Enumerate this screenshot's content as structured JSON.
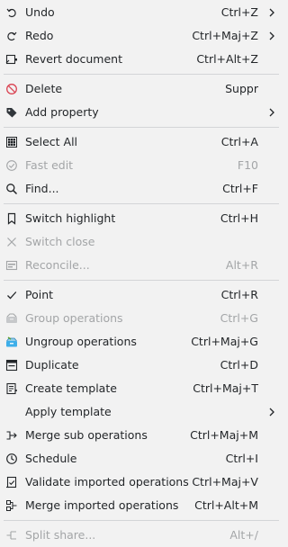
{
  "colors": {
    "background": "#f2f2f2",
    "text": "#232629",
    "disabled_text": "#a3a5a7",
    "separator": "#d3d5d7",
    "delete_icon": "#da4453"
  },
  "menu": {
    "items": [
      {
        "id": "undo",
        "label": "Undo",
        "shortcut": "Ctrl+Z",
        "enabled": true,
        "submenu": true,
        "icon": "undo-icon"
      },
      {
        "id": "redo",
        "label": "Redo",
        "shortcut": "Ctrl+Maj+Z",
        "enabled": true,
        "submenu": true,
        "icon": "redo-icon"
      },
      {
        "id": "revert-document",
        "label": "Revert document",
        "shortcut": "Ctrl+Alt+Z",
        "enabled": true,
        "submenu": false,
        "icon": "revert-icon"
      },
      {
        "id": "delete",
        "label": "Delete",
        "shortcut": "Suppr",
        "enabled": true,
        "submenu": false,
        "icon": "delete-icon"
      },
      {
        "id": "add-property",
        "label": "Add property",
        "shortcut": "",
        "enabled": true,
        "submenu": true,
        "icon": "tag-icon"
      },
      {
        "id": "select-all",
        "label": "Select All",
        "shortcut": "Ctrl+A",
        "enabled": true,
        "submenu": false,
        "icon": "select-all-icon"
      },
      {
        "id": "fast-edit",
        "label": "Fast edit",
        "shortcut": "F10",
        "enabled": false,
        "submenu": false,
        "icon": "check-circle-icon"
      },
      {
        "id": "find",
        "label": "Find...",
        "shortcut": "Ctrl+F",
        "enabled": true,
        "submenu": false,
        "icon": "search-icon"
      },
      {
        "id": "switch-highlight",
        "label": "Switch highlight",
        "shortcut": "Ctrl+H",
        "enabled": true,
        "submenu": false,
        "icon": "bookmark-icon"
      },
      {
        "id": "switch-close",
        "label": "Switch close",
        "shortcut": "",
        "enabled": false,
        "submenu": false,
        "icon": "close-icon"
      },
      {
        "id": "reconcile",
        "label": "Reconcile...",
        "shortcut": "Alt+R",
        "enabled": false,
        "submenu": false,
        "icon": "reconcile-icon"
      },
      {
        "id": "point",
        "label": "Point",
        "shortcut": "Ctrl+R",
        "enabled": true,
        "submenu": false,
        "icon": "checkmark-icon"
      },
      {
        "id": "group-operations",
        "label": "Group operations",
        "shortcut": "Ctrl+G",
        "enabled": false,
        "submenu": false,
        "icon": "group-icon"
      },
      {
        "id": "ungroup-operations",
        "label": "Ungroup operations",
        "shortcut": "Ctrl+Maj+G",
        "enabled": true,
        "submenu": false,
        "icon": "ungroup-icon"
      },
      {
        "id": "duplicate",
        "label": "Duplicate",
        "shortcut": "Ctrl+D",
        "enabled": true,
        "submenu": false,
        "icon": "duplicate-icon"
      },
      {
        "id": "create-template",
        "label": "Create template",
        "shortcut": "Ctrl+Maj+T",
        "enabled": true,
        "submenu": false,
        "icon": "template-icon"
      },
      {
        "id": "apply-template",
        "label": "Apply template",
        "shortcut": "",
        "enabled": true,
        "submenu": true,
        "icon": ""
      },
      {
        "id": "merge-sub-operations",
        "label": "Merge sub operations",
        "shortcut": "Ctrl+Maj+M",
        "enabled": true,
        "submenu": false,
        "icon": "merge-icon"
      },
      {
        "id": "schedule",
        "label": "Schedule",
        "shortcut": "Ctrl+I",
        "enabled": true,
        "submenu": false,
        "icon": "clock-icon"
      },
      {
        "id": "validate-imported-operations",
        "label": "Validate imported operations",
        "shortcut": "Ctrl+Maj+V",
        "enabled": true,
        "submenu": false,
        "icon": "validate-icon"
      },
      {
        "id": "merge-imported-operations",
        "label": "Merge imported operations",
        "shortcut": "Ctrl+Alt+M",
        "enabled": true,
        "submenu": false,
        "icon": "merge-imported-icon"
      },
      {
        "id": "split-share",
        "label": "Split share...",
        "shortcut": "Alt+/",
        "enabled": false,
        "submenu": false,
        "icon": "split-icon"
      }
    ]
  }
}
